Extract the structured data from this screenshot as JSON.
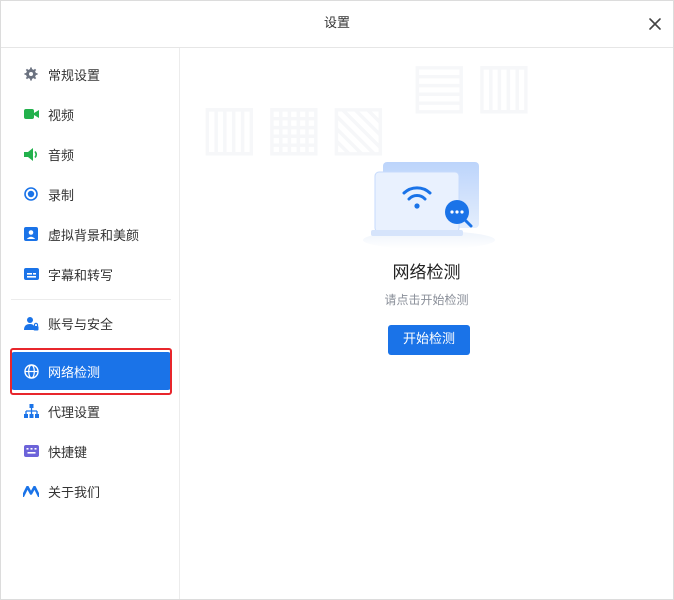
{
  "window": {
    "title": "设置"
  },
  "sidebar": {
    "items": [
      {
        "label": "常规设置",
        "icon": "gear-icon"
      },
      {
        "label": "视频",
        "icon": "video-camera-icon"
      },
      {
        "label": "音频",
        "icon": "speaker-icon"
      },
      {
        "label": "录制",
        "icon": "record-icon"
      },
      {
        "label": "虚拟背景和美颜",
        "icon": "person-portrait-icon"
      },
      {
        "label": "字幕和转写",
        "icon": "subtitle-icon"
      },
      {
        "label": "账号与安全",
        "icon": "user-lock-icon"
      },
      {
        "label": "网络检测",
        "icon": "globe-icon",
        "active": true
      },
      {
        "label": "代理设置",
        "icon": "network-tree-icon"
      },
      {
        "label": "快捷键",
        "icon": "keyboard-icon"
      },
      {
        "label": "关于我们",
        "icon": "brand-logo-icon"
      }
    ]
  },
  "main": {
    "heading": "网络检测",
    "subtitle": "请点击开始检测",
    "button_label": "开始检测"
  },
  "colors": {
    "accent": "#1a73e8",
    "highlight_border": "#e8262c"
  }
}
